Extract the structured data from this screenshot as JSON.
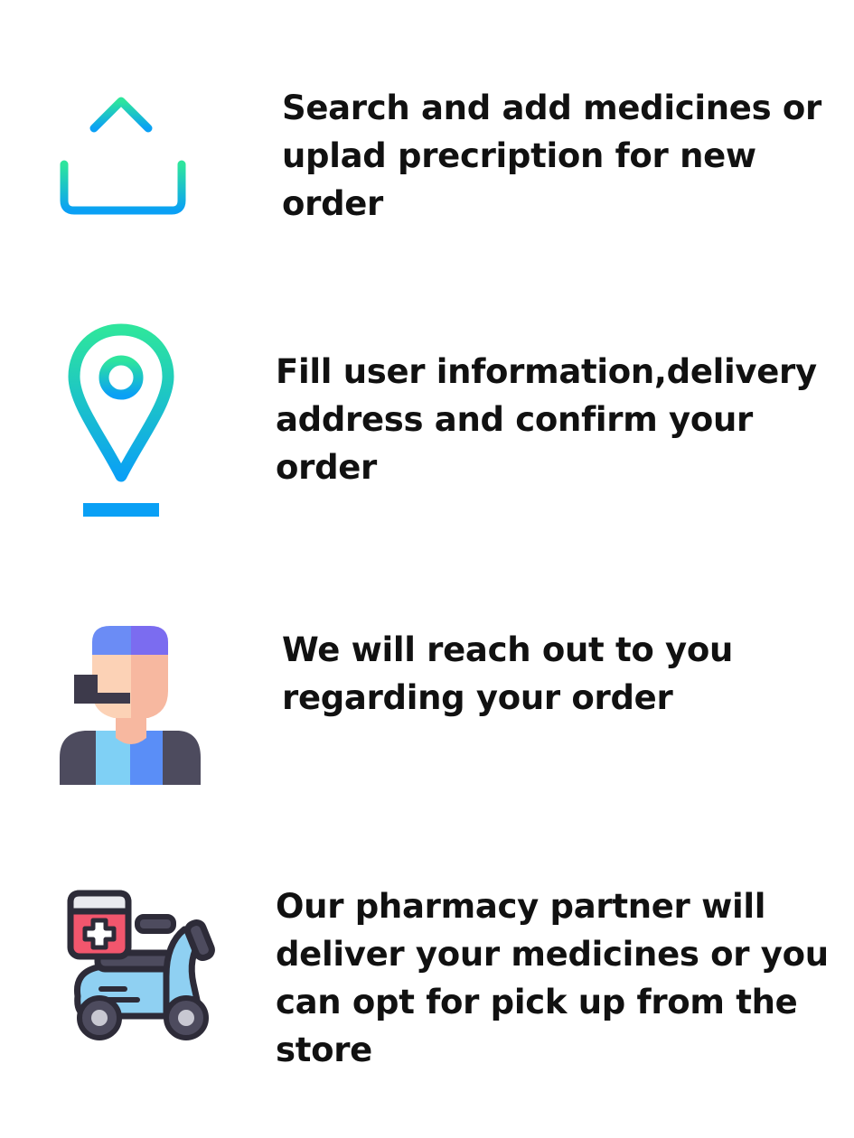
{
  "steps": [
    {
      "icon": "upload-icon",
      "text": "Search and add medicines or uplad precription for new order"
    },
    {
      "icon": "location-pin-icon",
      "text": "Fill user information,delivery address and confirm your order"
    },
    {
      "icon": "support-agent-icon",
      "text": "We will reach out to you regarding your order"
    },
    {
      "icon": "delivery-scooter-icon",
      "text": "Our pharmacy partner will deliver your medicines or you can opt for pick up from the store"
    }
  ],
  "colors": {
    "gradient_green": "#2ee59d",
    "gradient_blue": "#0aa0f5",
    "text": "#111111",
    "agent_cap_light": "#6b8cf5",
    "agent_cap_dark": "#7b6cf0",
    "agent_skin": "#fcd2b6",
    "agent_skin_shade": "#f7b8a0",
    "agent_mic": "#3d3a4b",
    "agent_shirt_light": "#7fd0f5",
    "agent_shirt_blue": "#5a8ef7",
    "agent_jacket": "#4d4b5e",
    "scooter_body": "#8fd0f2",
    "scooter_outline": "#2d2b38",
    "box_red": "#f2566d",
    "box_top": "#e9e9ee",
    "wheel_hub": "#c8c8d2"
  }
}
